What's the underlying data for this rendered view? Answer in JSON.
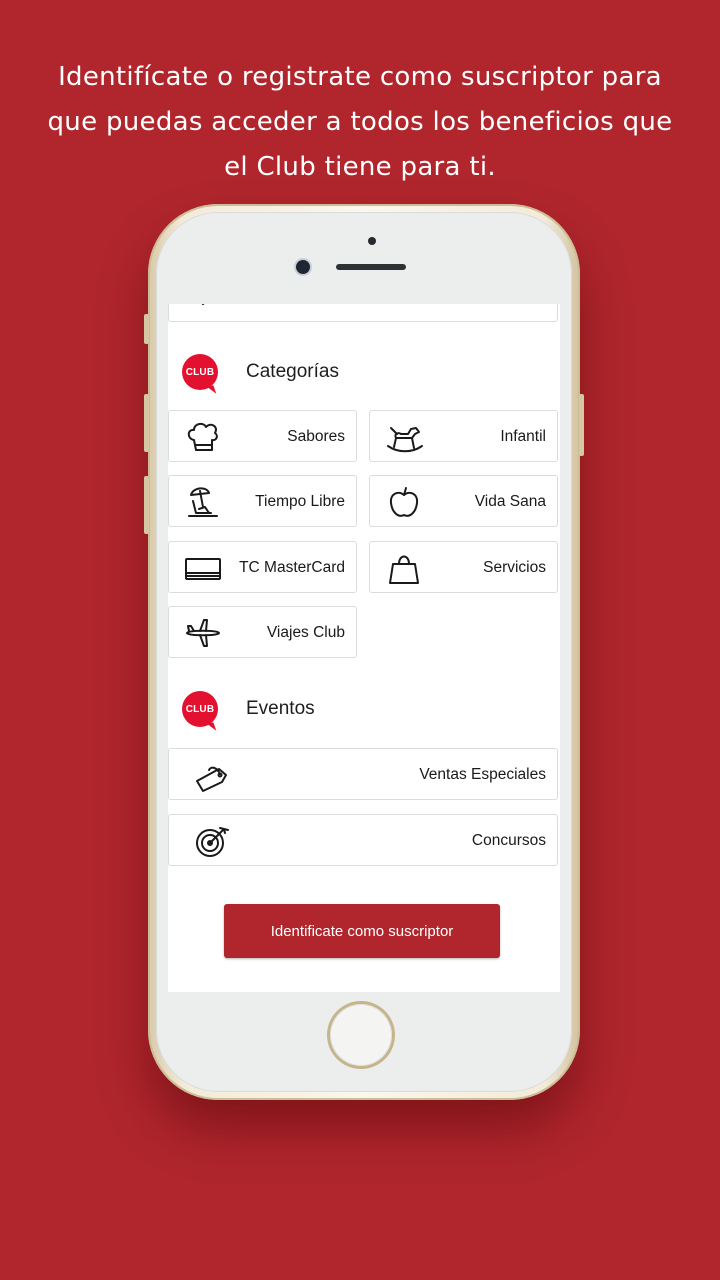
{
  "promo": {
    "headline": "Identifícate o registrate como suscriptor para que puedas acceder a todos los  beneficios que el Club tiene para ti."
  },
  "colors": {
    "background": "#b1262d",
    "club_red": "#e3102f",
    "button": "#b1262d"
  },
  "app": {
    "logo_text": "CLUB",
    "categorias": {
      "title": "Categorías",
      "items": [
        {
          "label": "Sabores",
          "icon": "chef-hat-icon"
        },
        {
          "label": "Infantil",
          "icon": "rocking-horse-icon"
        },
        {
          "label": "Tiempo Libre",
          "icon": "beach-umbrella-icon"
        },
        {
          "label": "Vida Sana",
          "icon": "apple-icon"
        },
        {
          "label": "TC MasterCard",
          "icon": "credit-card-icon"
        },
        {
          "label": "Servicios",
          "icon": "shopping-bag-icon"
        },
        {
          "label": "Viajes Club",
          "icon": "airplane-icon"
        }
      ]
    },
    "eventos": {
      "title": "Eventos",
      "items": [
        {
          "label": "Ventas Especiales",
          "icon": "price-tag-icon"
        },
        {
          "label": "Concursos",
          "icon": "target-icon"
        }
      ]
    },
    "cta_label": "Identificate como suscriptor"
  }
}
